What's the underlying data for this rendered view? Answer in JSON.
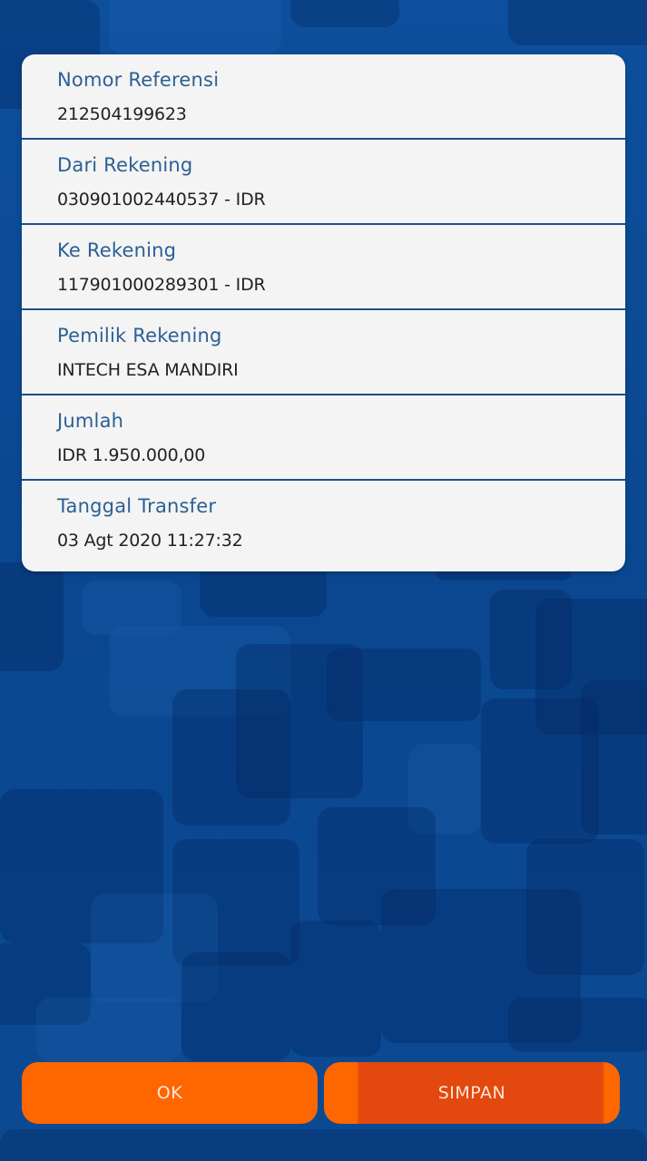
{
  "details": [
    {
      "label": "Nomor Referensi",
      "value": "212504199623"
    },
    {
      "label": "Dari Rekening",
      "value": "030901002440537 - IDR"
    },
    {
      "label": "Ke Rekening",
      "value": "117901000289301 - IDR"
    },
    {
      "label": "Pemilik Rekening",
      "value": "INTECH ESA MANDIRI"
    },
    {
      "label": "Jumlah",
      "value": "IDR 1.950.000,00"
    },
    {
      "label": "Tanggal Transfer",
      "value": "03 Agt 2020 11:27:32"
    }
  ],
  "buttons": {
    "ok_label": "OK",
    "simpan_label": "SIMPAN"
  },
  "colors": {
    "background": "#0a4a94",
    "card": "#f4f4f4",
    "label_text": "#2c5f95",
    "divider": "#1d4f8a",
    "button_orange": "#fe6600",
    "button_pressed": "#e3480f"
  }
}
